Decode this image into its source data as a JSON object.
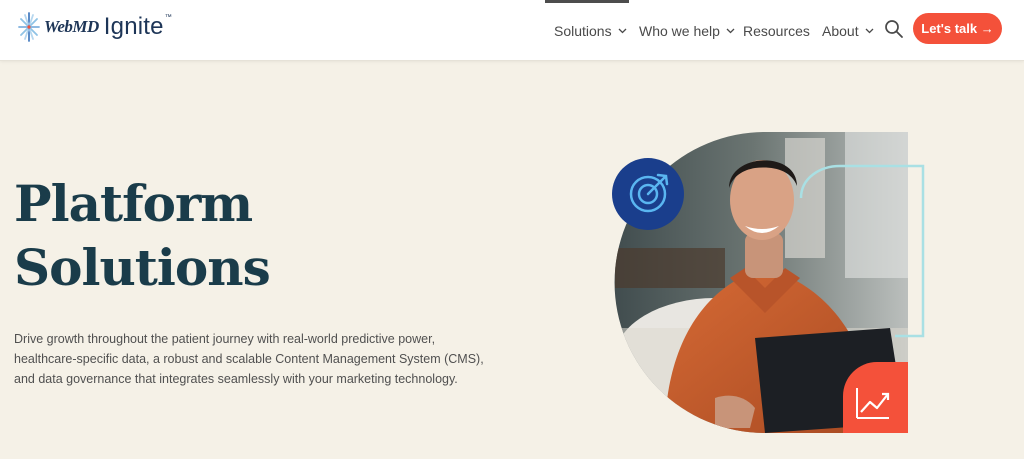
{
  "brand": {
    "name_part1": "WebMD",
    "name_part2": "Ignite",
    "trademark": "™"
  },
  "nav": {
    "items": [
      {
        "label": "Solutions",
        "has_dropdown": true,
        "active": true
      },
      {
        "label": "Who we help",
        "has_dropdown": true,
        "active": false
      },
      {
        "label": "Resources",
        "has_dropdown": false,
        "active": false
      },
      {
        "label": "About",
        "has_dropdown": true,
        "active": false
      }
    ],
    "cta_label": "Let's talk →"
  },
  "hero": {
    "title_line1": "Platform",
    "title_line2": "Solutions",
    "description_line1": "Drive growth throughout the patient journey with real-world predictive power,",
    "description_line2": "healthcare-specific data, a robust and scalable Content Management System (CMS),",
    "description_line3": "and data governance that integrates seamlessly with your marketing technology."
  },
  "colors": {
    "background": "#f5f1e7",
    "header": "#ffffff",
    "title": "#1a3c4a",
    "cta": "#f4513a",
    "target_badge": "#1a3e8c",
    "chart_badge": "#f4513a",
    "outline_accent": "#a9e0e4"
  },
  "icons": [
    "brand-burst-icon",
    "chevron-down-icon",
    "search-icon",
    "target-arrow-icon",
    "trend-up-chart-icon"
  ]
}
